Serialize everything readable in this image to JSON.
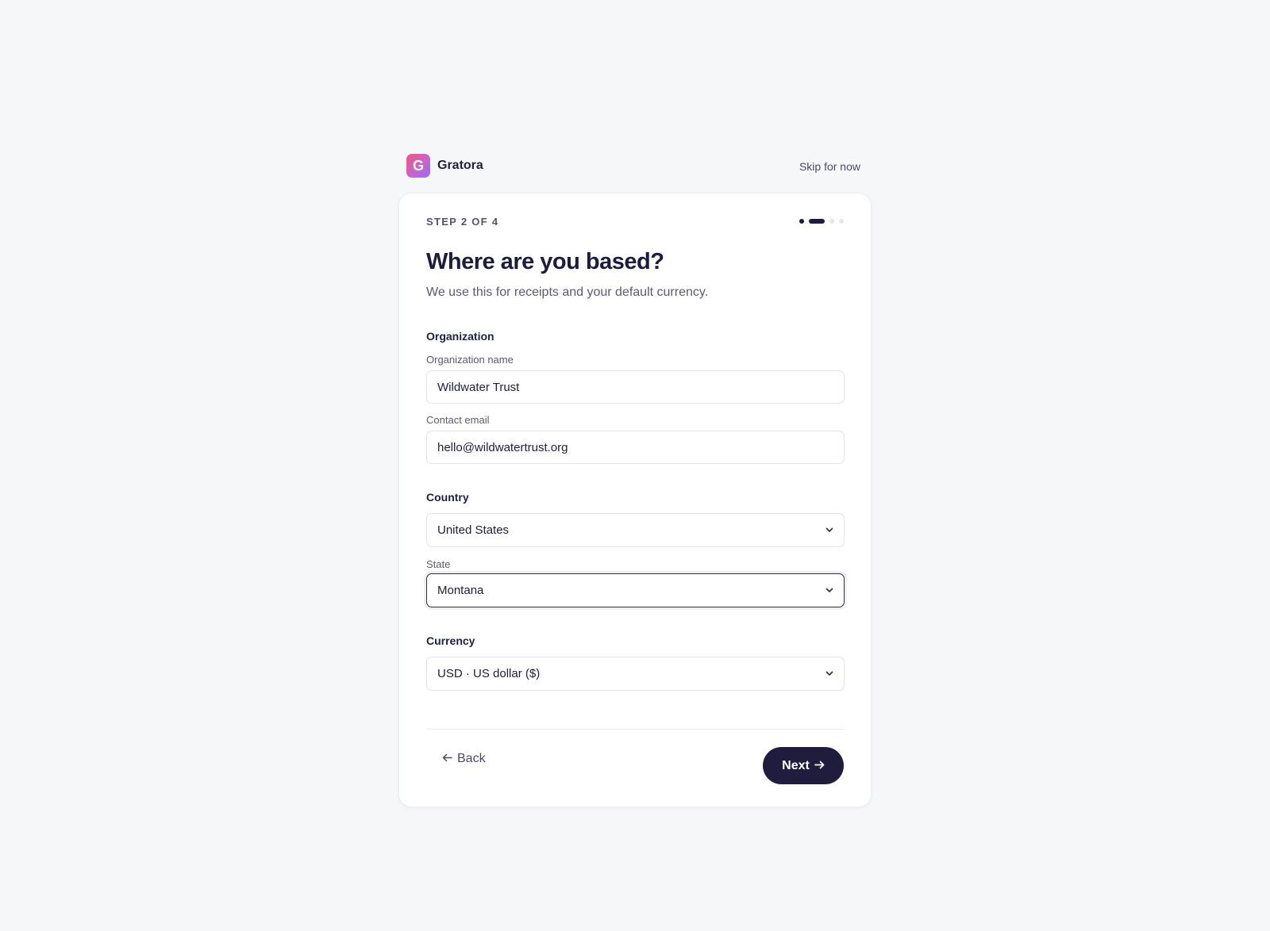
{
  "brand": {
    "logo_letter": "G",
    "name": "Gratora"
  },
  "header": {
    "skip_label": "Skip for now"
  },
  "progress": {
    "label": "STEP 2 OF 4",
    "current_step": 2,
    "total_steps": 4
  },
  "page": {
    "title": "Where are you based?",
    "subtitle": "We use this for receipts and your default currency."
  },
  "organization": {
    "section_title": "Organization",
    "name_label": "Organization name",
    "name_value": "Wildwater Trust",
    "email_label": "Contact email",
    "email_value": "hello@wildwatertrust.org"
  },
  "country": {
    "section_title": "Country",
    "country_value": "United States",
    "state_label": "State",
    "state_value": "Montana"
  },
  "currency": {
    "section_title": "Currency",
    "value": "USD · US dollar ($)"
  },
  "footer": {
    "back_label": "Back",
    "back_icon": "arrow-left-icon",
    "next_label": "Next",
    "next_icon": "arrow-right-icon"
  },
  "colors": {
    "primary": "#1f1c3e",
    "background": "#f6f7f9",
    "logo_gradient_start": "#f0597a",
    "logo_gradient_end": "#9b6df0"
  }
}
